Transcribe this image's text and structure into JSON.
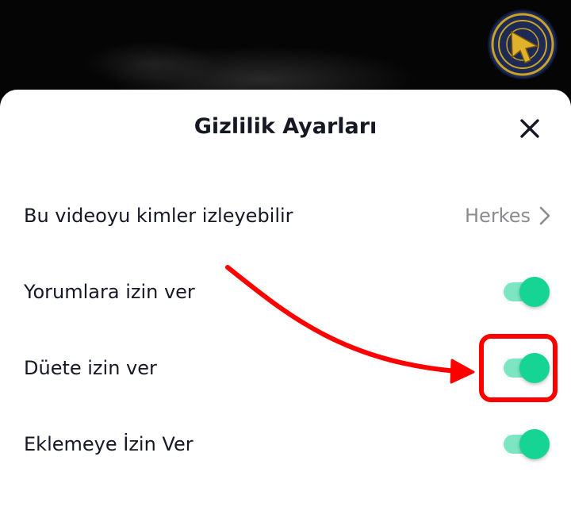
{
  "header": {
    "title": "Gizlilik Ayarları",
    "close_icon": "close-icon"
  },
  "settings": [
    {
      "label": "Bu videoyu kimler izleyebilir",
      "type": "select",
      "value": "Herkes",
      "icon": "chevron-right-icon"
    },
    {
      "label": "Yorumlara izin ver",
      "type": "toggle",
      "enabled": true
    },
    {
      "label": "Düete izin ver",
      "type": "toggle",
      "enabled": true,
      "highlighted": true
    },
    {
      "label": "Eklemeye İzin Ver",
      "type": "toggle",
      "enabled": true
    }
  ],
  "colors": {
    "toggle_on_knob": "#16d494",
    "toggle_on_track": "#7ce6c2",
    "annotation": "#ff0000",
    "title_text": "#161823",
    "secondary_text": "#8a8b91"
  },
  "annotation": {
    "arrow_icon": "curved-arrow-annotation",
    "highlight_box": "red-highlight-box"
  }
}
